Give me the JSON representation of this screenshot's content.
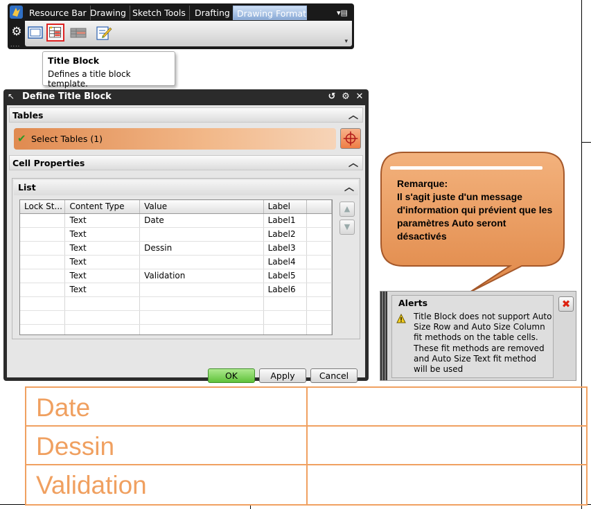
{
  "ribbon": {
    "tabs": [
      {
        "label": "Resource Bar"
      },
      {
        "label": "Drawing"
      },
      {
        "label": "Sketch Tools"
      },
      {
        "label": "Drafting"
      },
      {
        "label": "Drawing Format"
      }
    ],
    "active_tab": "Drawing Format",
    "icons": [
      "drawing-sheet-icon",
      "title-block-icon",
      "table-icon",
      "edit-template-icon"
    ]
  },
  "tooltip": {
    "title": "Title Block",
    "text": "Defines a title block template."
  },
  "dialog": {
    "title": "Define Title Block",
    "tables_section": "Tables",
    "select_tables_label": "Select Tables (1)",
    "cell_properties_section": "Cell Properties",
    "list_header": "List",
    "columns": [
      "Lock St...",
      "Content Type",
      "Value",
      "Label"
    ],
    "rows": [
      {
        "lock": "",
        "type": "Text",
        "value": "Date",
        "label": "Label1"
      },
      {
        "lock": "",
        "type": "Text",
        "value": "",
        "label": "Label2"
      },
      {
        "lock": "",
        "type": "Text",
        "value": "Dessin",
        "label": "Label3"
      },
      {
        "lock": "",
        "type": "Text",
        "value": "",
        "label": "Label4"
      },
      {
        "lock": "",
        "type": "Text",
        "value": "Validation",
        "label": "Label5"
      },
      {
        "lock": "",
        "type": "Text",
        "value": "",
        "label": "Label6"
      }
    ],
    "ok_label": "OK",
    "apply_label": "Apply",
    "cancel_label": "Cancel"
  },
  "callout": {
    "heading": "Remarque:",
    "text": "Il s'agit juste d'un message d'information qui prévient que les paramètres Auto seront désactivés"
  },
  "alerts": {
    "title": "Alerts",
    "message": "Title Block does not support Auto Size Row and Auto Size Column fit methods on the table cells. These fit methods are removed and Auto Size Text fit method will be used"
  },
  "title_block": {
    "rows": [
      {
        "label": "Date"
      },
      {
        "label": "Dessin"
      },
      {
        "label": "Validation"
      }
    ]
  },
  "colors": {
    "accent_orange": "#f0a060",
    "select_row_orange": "#e08a50",
    "ok_green": "#5fc23a",
    "ribbon_dark": "#1a1a1a",
    "callout_fill": "#e9955c"
  }
}
